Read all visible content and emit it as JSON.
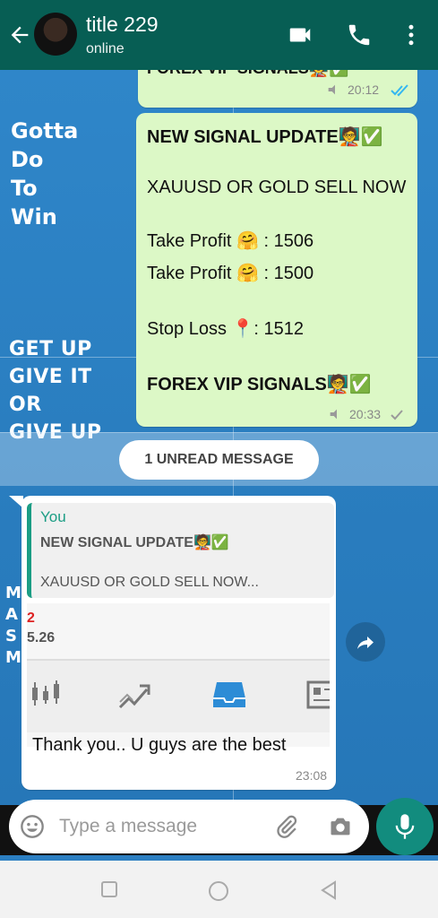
{
  "header": {
    "title": "title 229",
    "status": "online"
  },
  "wallpaper": {
    "lines1": [
      "Gotta",
      "Do",
      "To",
      "Win"
    ],
    "lines2": [
      "GET UP",
      "GIVE IT",
      "OR",
      "GIVE UP"
    ],
    "lines3": [
      "M",
      "A",
      "S",
      "M"
    ]
  },
  "messages": {
    "prev": {
      "text": "FOREX VIP SIGNALS🧑‍🏫✅",
      "time": "20:12"
    },
    "signal": {
      "title": "NEW SIGNAL UPDATE🧑‍🏫✅",
      "line1": "XAUUSD OR GOLD SELL NOW",
      "tp1": "Take Profit 🤗 : 1506",
      "tp2": "Take Profit 🤗 : 1500",
      "sl": "Stop Loss 📍: 1512",
      "footer": "FOREX VIP SIGNALS🧑‍🏫✅",
      "time": "20:33"
    },
    "unread_label": "1 UNREAD MESSAGE",
    "reply": {
      "quote_author": "You",
      "quote_line1": "NEW SIGNAL UPDATE🧑‍🏫✅",
      "quote_line2": "XAUUSD OR GOLD SELL NOW...",
      "preview_red": "2",
      "preview_num": "5.26",
      "text": "Thank you.. U guys are the best",
      "time": "23:08"
    }
  },
  "composer": {
    "placeholder": "Type a message"
  },
  "colors": {
    "header": "#075e54",
    "outgoing": "#dcf8c6",
    "accent": "#128c7e"
  },
  "icons": [
    "back-arrow-icon",
    "video-call-icon",
    "phone-icon",
    "more-vert-icon",
    "emoji-icon",
    "attach-icon",
    "camera-icon",
    "mic-icon",
    "forward-icon",
    "read-ticks-icon",
    "sent-tick-icon",
    "square-nav-icon",
    "circle-nav-icon",
    "triangle-nav-icon",
    "candles-icon",
    "trend-icon",
    "inbox-icon",
    "news-icon"
  ]
}
